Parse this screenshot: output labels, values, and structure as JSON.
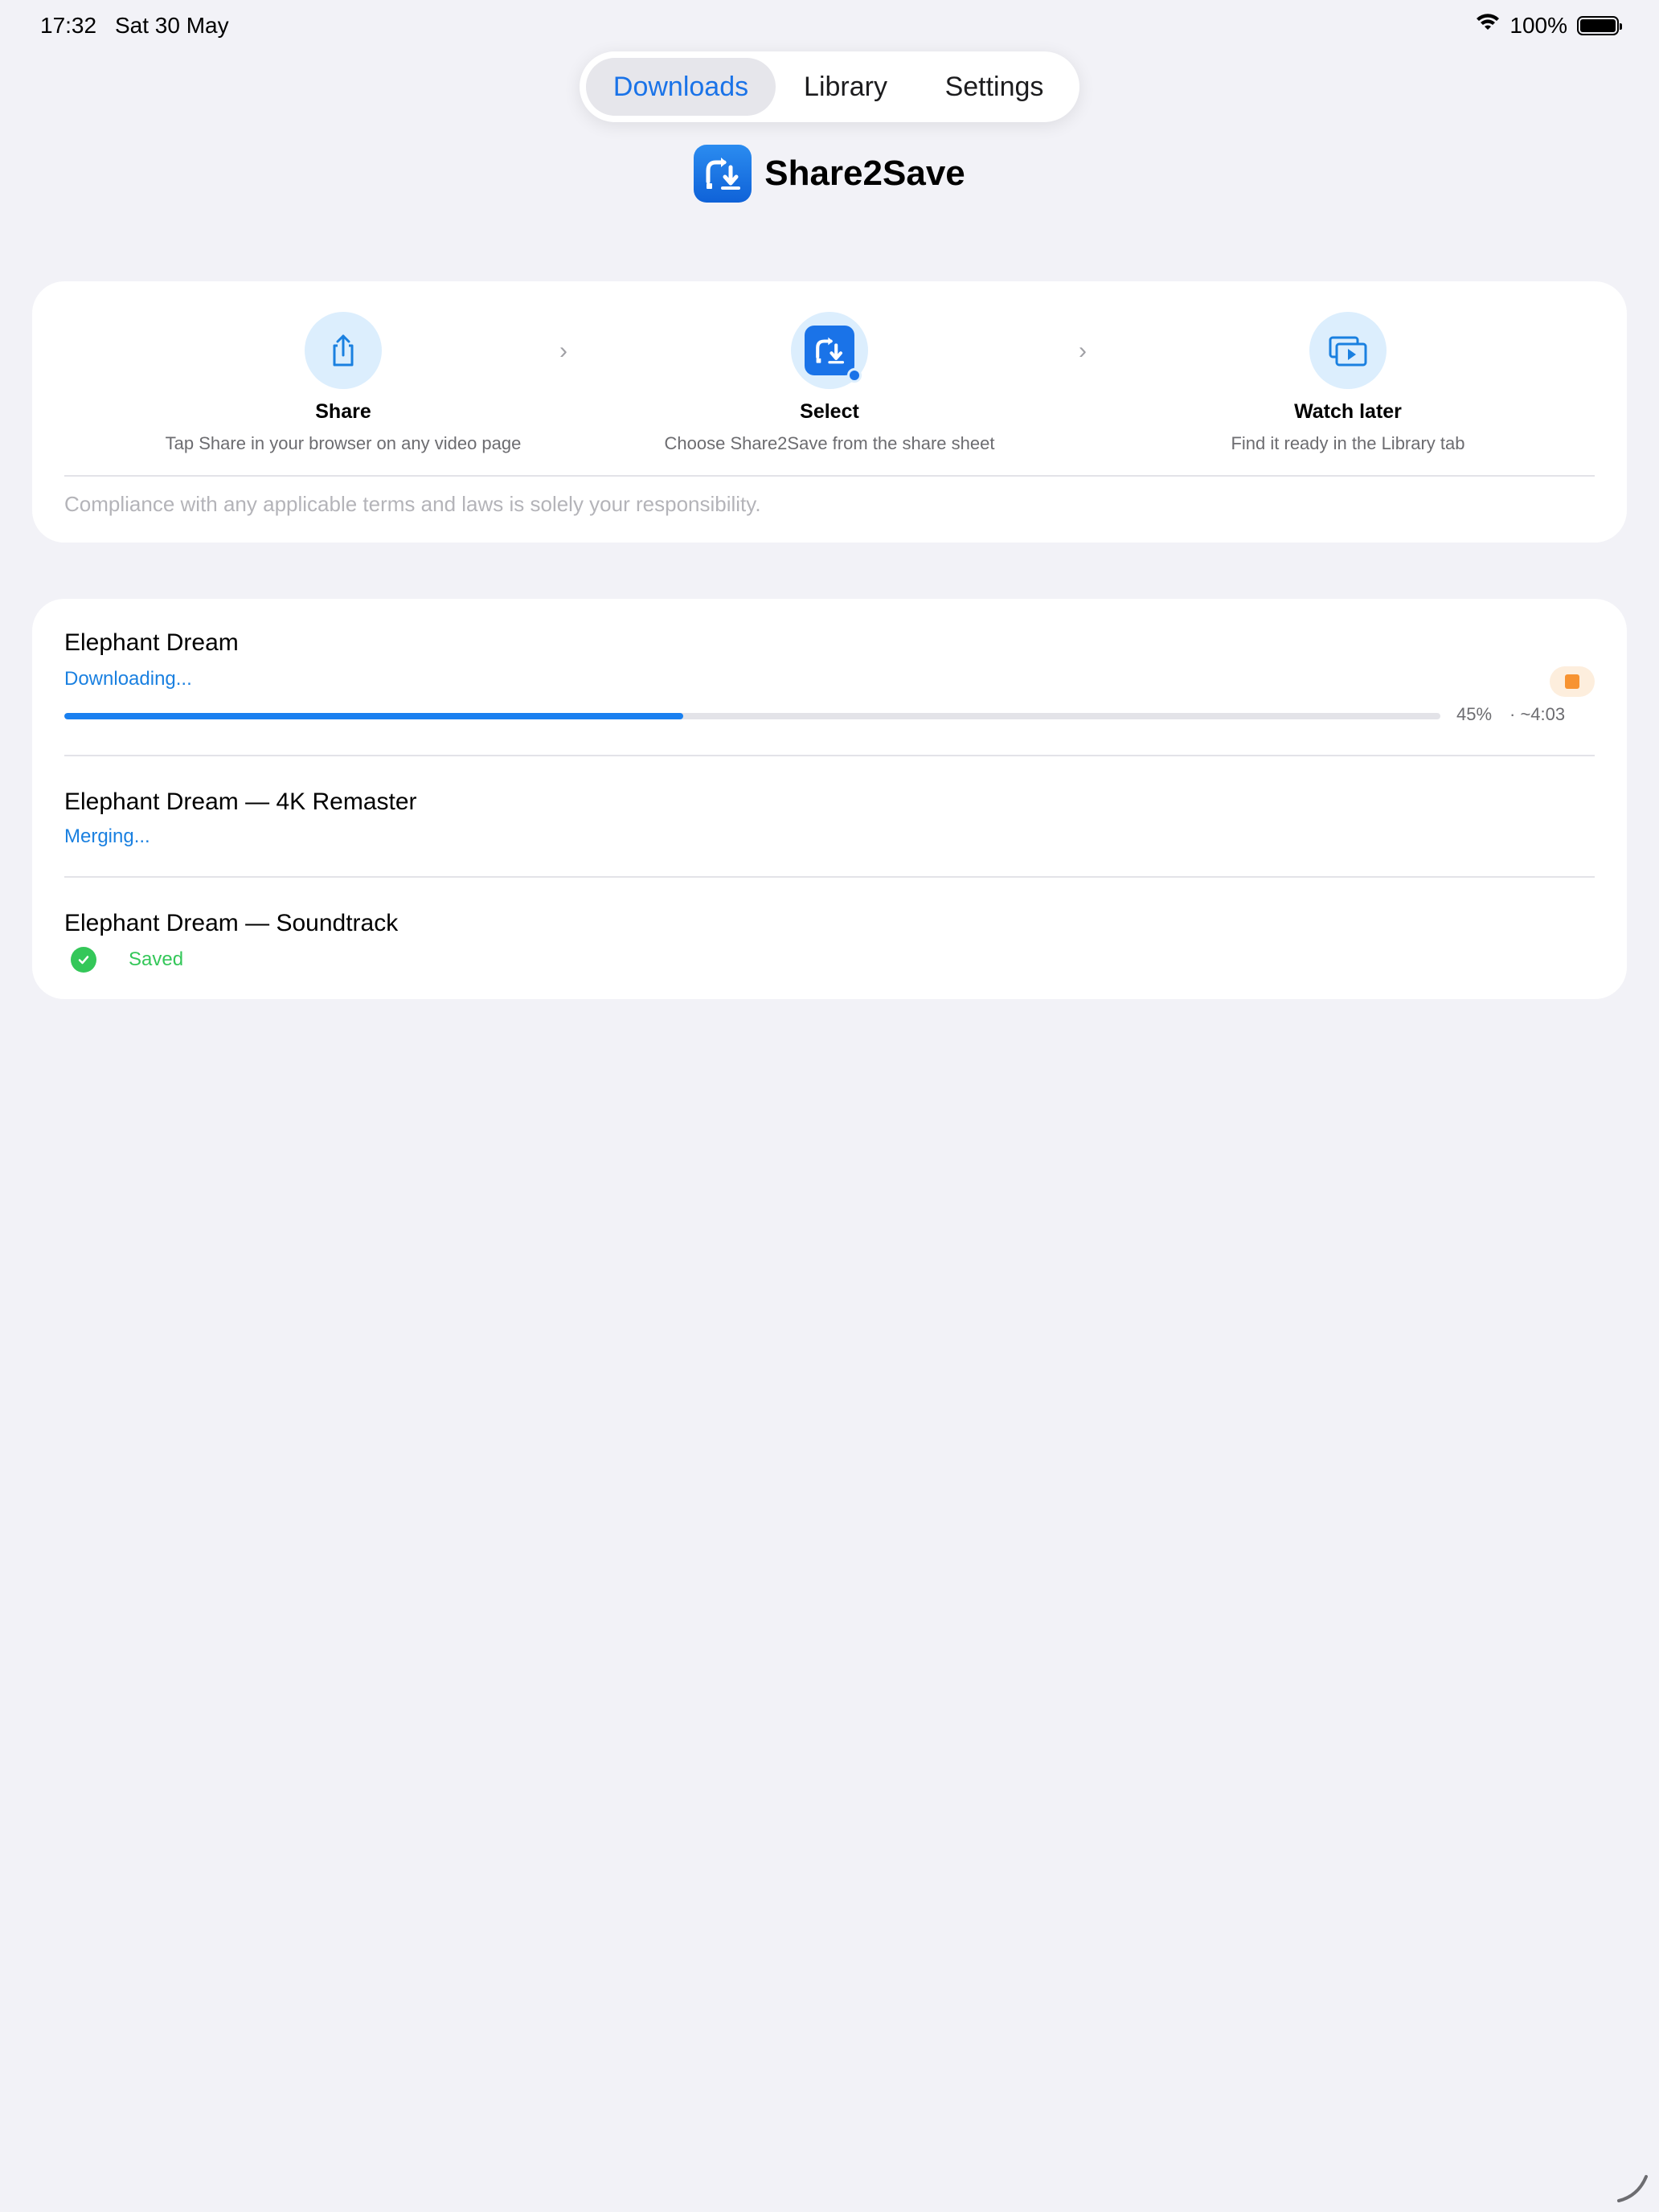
{
  "status_bar": {
    "time": "17:32",
    "date": "Sat 30 May",
    "battery_text": "100%",
    "wifi_icon": "wifi-icon",
    "battery_icon": "battery-icon"
  },
  "tabs": [
    {
      "label": "Downloads",
      "active": true
    },
    {
      "label": "Library",
      "active": false
    },
    {
      "label": "Settings",
      "active": false
    }
  ],
  "app": {
    "title": "Share2Save",
    "logo_icon": "share2save-logo-icon"
  },
  "steps": [
    {
      "title": "Share",
      "description": "Tap Share in your browser on any video page",
      "icon": "share-icon"
    },
    {
      "title": "Select",
      "description": "Choose Share2Save from the share sheet",
      "icon": "share2save-app-icon"
    },
    {
      "title": "Watch later",
      "description": "Find it ready in the Library tab",
      "icon": "video-library-icon"
    }
  ],
  "compliance_text": "Compliance with any applicable terms and laws is solely your responsibility.",
  "downloads": [
    {
      "title": "Elephant Dream",
      "status": "Downloading...",
      "progress_percent": 45,
      "progress_text": "45%",
      "eta_text": "· ~4:03",
      "action_icon": "stop-icon"
    },
    {
      "title": "Elephant Dream — 4K Remaster",
      "status": "Merging..."
    },
    {
      "title": "Elephant Dream — Soundtrack",
      "status": "Saved",
      "status_icon": "checkmark-circle-icon"
    }
  ],
  "colors": {
    "accent": "#1a80f0",
    "background": "#f2f2f7",
    "success": "#34c759",
    "stop": "#f79331"
  }
}
